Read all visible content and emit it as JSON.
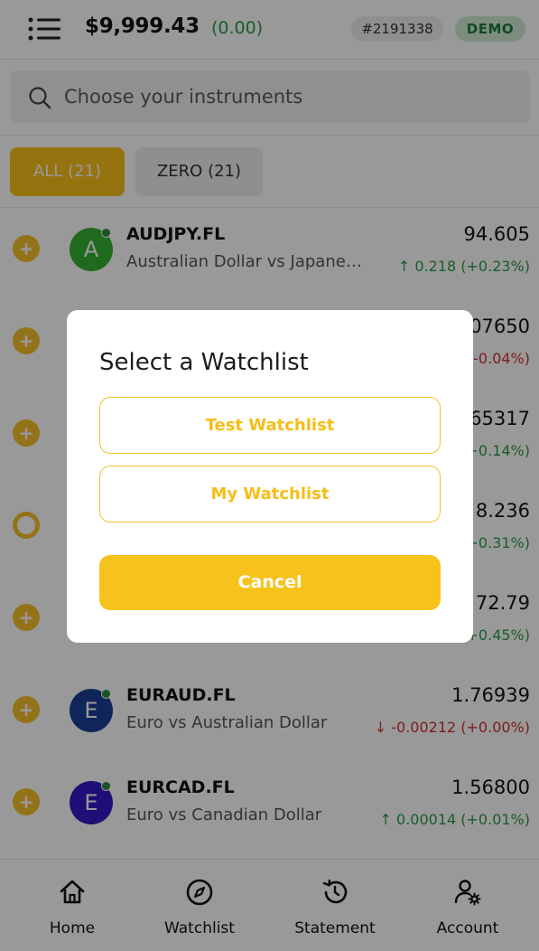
{
  "header": {
    "balance": "$9,999.43",
    "balance_change": "(0.00)",
    "account_id": "#2191338",
    "mode_badge": "DEMO"
  },
  "search": {
    "placeholder": "Choose your instruments"
  },
  "filters": [
    {
      "label": "ALL (21)",
      "active": true
    },
    {
      "label": "ZERO (21)",
      "active": false
    }
  ],
  "instruments": [
    {
      "avatar_letter": "A",
      "avatar_color": "#35b12f",
      "symbol": "AUDJPY.FL",
      "description": "Australian Dollar vs Japanese Yen",
      "price": "94.605",
      "change": "0.218 (+0.23%)",
      "direction": "up"
    },
    {
      "avatar_letter": "",
      "avatar_color": "#cccccc",
      "symbol": "",
      "description": "",
      "price": "07650",
      "change": "-0.04%)",
      "direction": "down"
    },
    {
      "avatar_letter": "",
      "avatar_color": "#cccccc",
      "symbol": "",
      "description": "",
      "price": "65317",
      "change": "+0.14%)",
      "direction": "up"
    },
    {
      "avatar_letter": "",
      "avatar_color": "#cccccc",
      "symbol": "",
      "description": "",
      "price": "8.236",
      "change": "+0.31%)",
      "direction": "up"
    },
    {
      "avatar_letter": "",
      "avatar_color": "#cccccc",
      "symbol": "",
      "description": "",
      "price": "72.79",
      "change": "+0.45%)",
      "direction": "up"
    },
    {
      "avatar_letter": "E",
      "avatar_color": "#1c3f94",
      "symbol": "EURAUD.FL",
      "description": "Euro vs Australian Dollar",
      "price": "1.76939",
      "change": "-0.00212 (+0.00%)",
      "direction": "down"
    },
    {
      "avatar_letter": "E",
      "avatar_color": "#3218c4",
      "symbol": "EURCAD.FL",
      "description": "Euro vs Canadian Dollar",
      "price": "1.56800",
      "change": "0.00014 (+0.01%)",
      "direction": "up"
    }
  ],
  "bottom_nav": [
    {
      "label": "Home",
      "icon": "home-icon"
    },
    {
      "label": "Watchlist",
      "icon": "compass-icon"
    },
    {
      "label": "Statement",
      "icon": "history-icon"
    },
    {
      "label": "Account",
      "icon": "user-settings-icon"
    }
  ],
  "modal": {
    "title": "Select a Watchlist",
    "options": [
      "Test Watchlist",
      "My Watchlist"
    ],
    "cancel_label": "Cancel"
  },
  "colors": {
    "accent": "#f8c21c",
    "up": "#2b9b47",
    "down": "#d12f2f",
    "demo_badge_bg": "#cfe9d4"
  }
}
